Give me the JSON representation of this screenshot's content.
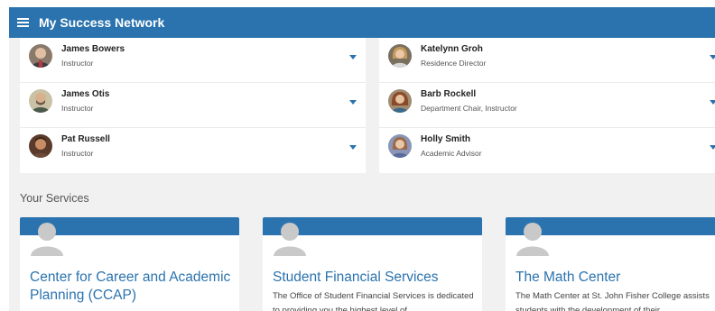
{
  "header": {
    "title": "My Success Network"
  },
  "network": {
    "left": [
      {
        "name": "James Bowers",
        "role": "Instructor"
      },
      {
        "name": "James Otis",
        "role": "Instructor"
      },
      {
        "name": "Pat Russell",
        "role": "Instructor"
      }
    ],
    "right": [
      {
        "name": "Katelynn Groh",
        "role": "Residence Director"
      },
      {
        "name": "Barb Rockell",
        "role": "Department Chair, Instructor"
      },
      {
        "name": "Holly Smith",
        "role": "Academic Advisor"
      }
    ]
  },
  "services": {
    "heading": "Your Services",
    "items": [
      {
        "title": "Center for Career and Academic Planning (CCAP)",
        "description": ""
      },
      {
        "title": "Student Financial Services",
        "description": "The Office of Student Financial Services is dedicated to providing you the highest level of"
      },
      {
        "title": "The Math Center",
        "description": "The Math Center at St. John Fisher College assists students with the development of their"
      }
    ]
  },
  "colors": {
    "primary": "#2b73ae",
    "background": "#f1f1f1",
    "card": "#ffffff"
  },
  "icons": {
    "menu": "hamburger-menu-icon",
    "expand": "chevron-down-icon",
    "placeholder": "user-silhouette-icon"
  }
}
